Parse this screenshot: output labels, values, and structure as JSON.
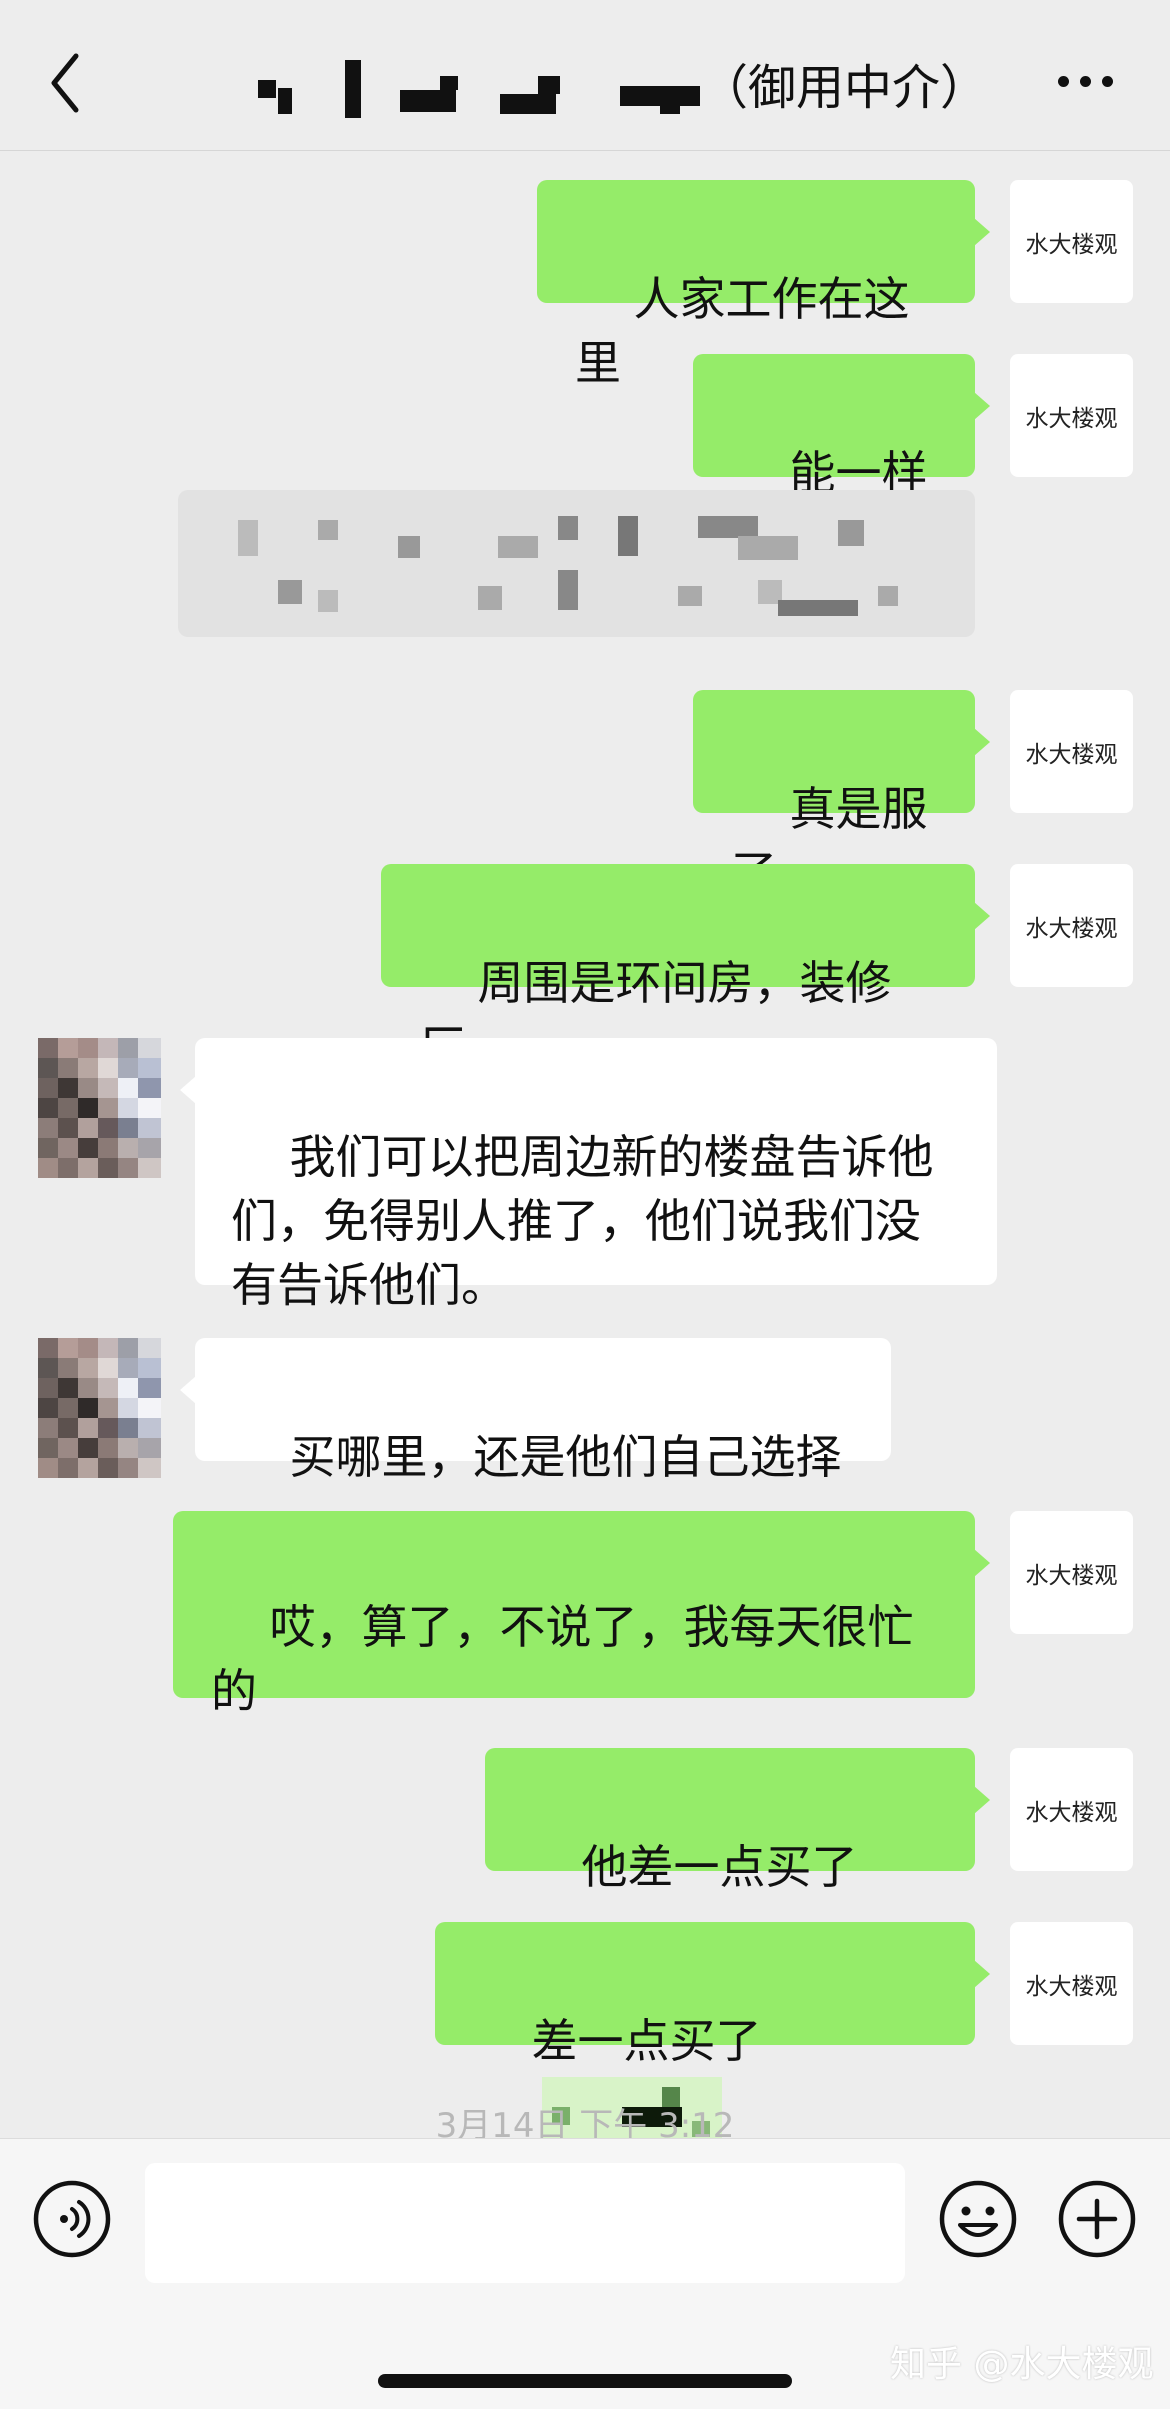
{
  "header": {
    "title_suffix": "（御用中介）",
    "back_icon": "chevron-left-icon",
    "more_icon": "more-dots-icon"
  },
  "self_avatar_text": "水大楼观",
  "messages": [
    {
      "sender": "me",
      "text": "人家工作在这里"
    },
    {
      "sender": "me",
      "text": "能一样吗"
    },
    {
      "sender": "me",
      "text": "真是服了"
    },
    {
      "sender": "me",
      "text": "周围是环间房，装修厂"
    },
    {
      "sender": "other",
      "text": "我们可以把周边新的楼盘告诉他们，免得别人推了，他们说我们没有告诉他们。"
    },
    {
      "sender": "other",
      "text": "买哪里，还是他们自己选择"
    },
    {
      "sender": "me",
      "text": "哎，算了，不说了，我每天很忙的"
    },
    {
      "sender": "me",
      "text": "他差一点买了"
    },
    {
      "sender": "me",
      "text": "差一点买了"
    }
  ],
  "timestamp": "3月14日 下午 3:12",
  "input_bar": {
    "placeholder": "",
    "voice_icon": "voice-icon",
    "emoji_icon": "emoji-icon",
    "plus_icon": "plus-icon"
  },
  "watermark": "知乎 @水大楼观",
  "colors": {
    "background": "#ededed",
    "my_bubble": "#95ec69",
    "other_bubble": "#ffffff"
  }
}
